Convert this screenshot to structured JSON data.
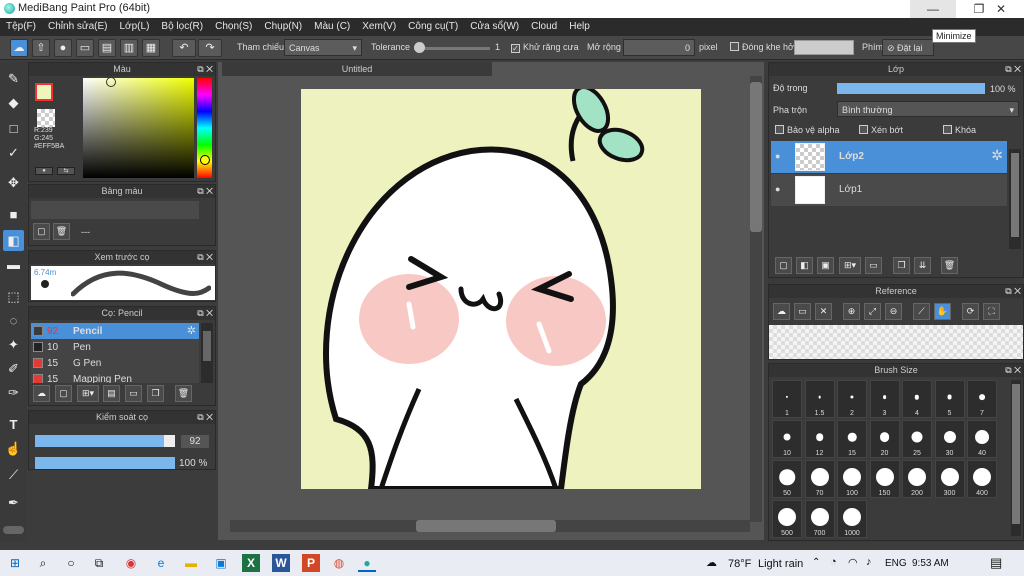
{
  "window": {
    "title": "MediBang Paint Pro (64bit)",
    "min": "—",
    "max": "❐",
    "close": "✕",
    "tooltip": "Minimize"
  },
  "menu": [
    "Tệp(F)",
    "Chỉnh sửa(E)",
    "Lớp(L)",
    "Bộ lọc(R)",
    "Chọn(S)",
    "Chụp(N)",
    "Màu (C)",
    "Xem(V)",
    "Công cụ(T)",
    "Cửa sổ(W)",
    "Cloud",
    "Help"
  ],
  "toolbar": {
    "ref_label": "Tham chiếu",
    "ref_value": "Canvas",
    "tolerance_label": "Tolerance",
    "tolerance_value": "1",
    "antialias_label": "Khử răng cưa",
    "expand_label": "Mở rộng",
    "expand_value": "0",
    "expand_unit": "pixel",
    "close_gap_label": "Đóng khe hở",
    "key_label": "Phím",
    "reset_label": "Đặt lại"
  },
  "color_panel": {
    "title": "Màu",
    "r": "R:239",
    "g": "G:245",
    "hex": "#EFF5BA",
    "fg": "#EFF5BA"
  },
  "palette_panel": {
    "title": "Bảng màu",
    "value": "---"
  },
  "brush_preview": {
    "title": "Xem trước cọ",
    "size": "6.74m"
  },
  "brush_panel": {
    "title": "Cọ: Pencil",
    "items": [
      {
        "size": "92",
        "name": "Pencil",
        "color": "#3b3b3b",
        "selected": true
      },
      {
        "size": "10",
        "name": "Pen",
        "color": "#222222",
        "selected": false
      },
      {
        "size": "15",
        "name": "G Pen",
        "color": "#e53935",
        "selected": false
      },
      {
        "size": "15",
        "name": "Mapping Pen",
        "color": "#e53935",
        "selected": false
      }
    ]
  },
  "brush_control": {
    "title": "Kiểm soát cọ",
    "size_value": "92",
    "size_level": 0.92,
    "opacity_value": "100 %",
    "opacity_level": 1.0
  },
  "canvas": {
    "tab": "Untitled"
  },
  "layer_panel": {
    "title": "Lớp",
    "opacity_label": "Độ trong",
    "opacity_value": "100 %",
    "opacity_level": 1.0,
    "blend_label": "Pha trộn",
    "blend_value": "Bình thường",
    "protect_alpha": "Bảo vệ alpha",
    "clip": "Xén bớt",
    "lock": "Khóa",
    "layers": [
      {
        "name": "Lớp2",
        "selected": true
      },
      {
        "name": "Lớp1",
        "selected": false
      }
    ]
  },
  "reference_panel": {
    "title": "Reference"
  },
  "brush_size_panel": {
    "title": "Brush Size",
    "sizes": [
      "1",
      "1.5",
      "2",
      "3",
      "4",
      "5",
      "7",
      "10",
      "12",
      "15",
      "20",
      "25",
      "30",
      "40",
      "50",
      "70",
      "100",
      "150",
      "200",
      "300",
      "400",
      "500",
      "700",
      "1000"
    ]
  },
  "taskbar": {
    "weather": "78°F",
    "weather_desc": "Light rain",
    "lang": "ENG",
    "time": "9:53 AM"
  }
}
